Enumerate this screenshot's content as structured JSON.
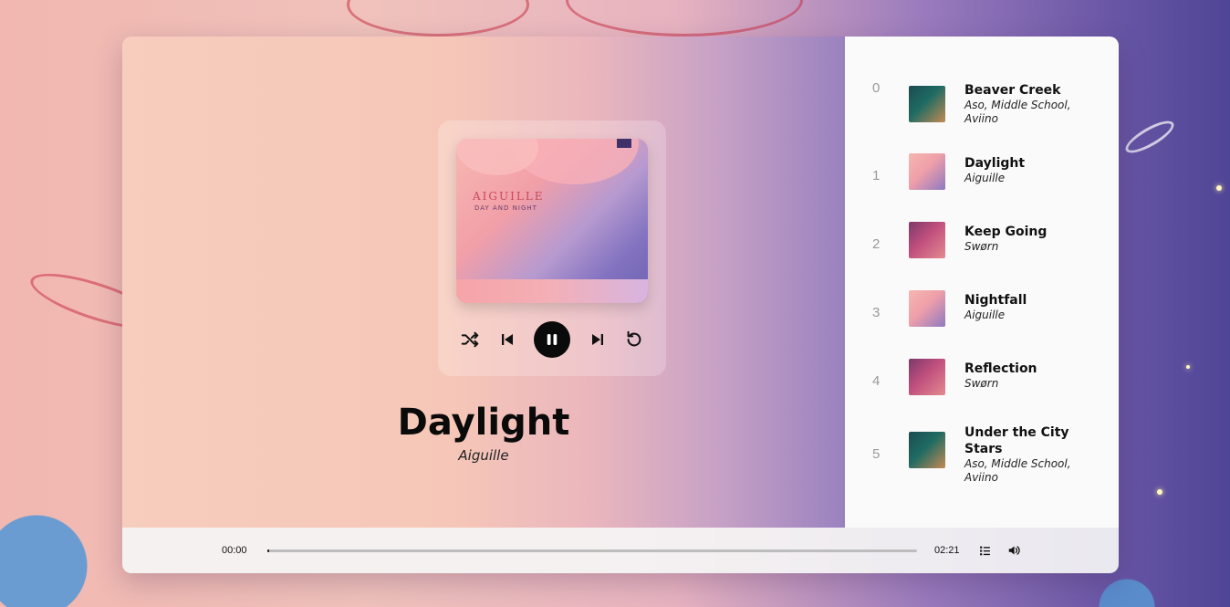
{
  "now_playing": {
    "title": "Daylight",
    "artist": "Aiguille",
    "cover": {
      "title": "AIGUILLE",
      "subtitle": "DAY AND NIGHT"
    }
  },
  "controls": {
    "shuffle_icon": "shuffle-icon",
    "previous_icon": "skip-previous-icon",
    "play_pause_icon": "pause-icon",
    "next_icon": "skip-next-icon",
    "repeat_icon": "repeat-icon"
  },
  "playlist": [
    {
      "index": "0",
      "title": "Beaver Creek",
      "artist": "Aso, Middle School, Aviino",
      "thumb": "teal"
    },
    {
      "index": "1",
      "title": "Daylight",
      "artist": "Aiguille",
      "thumb": "pink"
    },
    {
      "index": "2",
      "title": "Keep Going",
      "artist": "Swørn",
      "thumb": "purple"
    },
    {
      "index": "3",
      "title": "Nightfall",
      "artist": "Aiguille",
      "thumb": "pink"
    },
    {
      "index": "4",
      "title": "Reflection",
      "artist": "Swørn",
      "thumb": "purple"
    },
    {
      "index": "5",
      "title": "Under the City Stars",
      "artist": "Aso, Middle School, Aviino",
      "thumb": "teal"
    }
  ],
  "bar": {
    "current_time": "00:00",
    "total_time": "02:21",
    "progress": 0.0,
    "playlist_icon": "list-icon",
    "volume_icon": "volume-icon"
  },
  "colors": {
    "accent": "#0a0a0a",
    "progress_track": "#bdbdbd",
    "playlist_bg": "#fafafa"
  }
}
